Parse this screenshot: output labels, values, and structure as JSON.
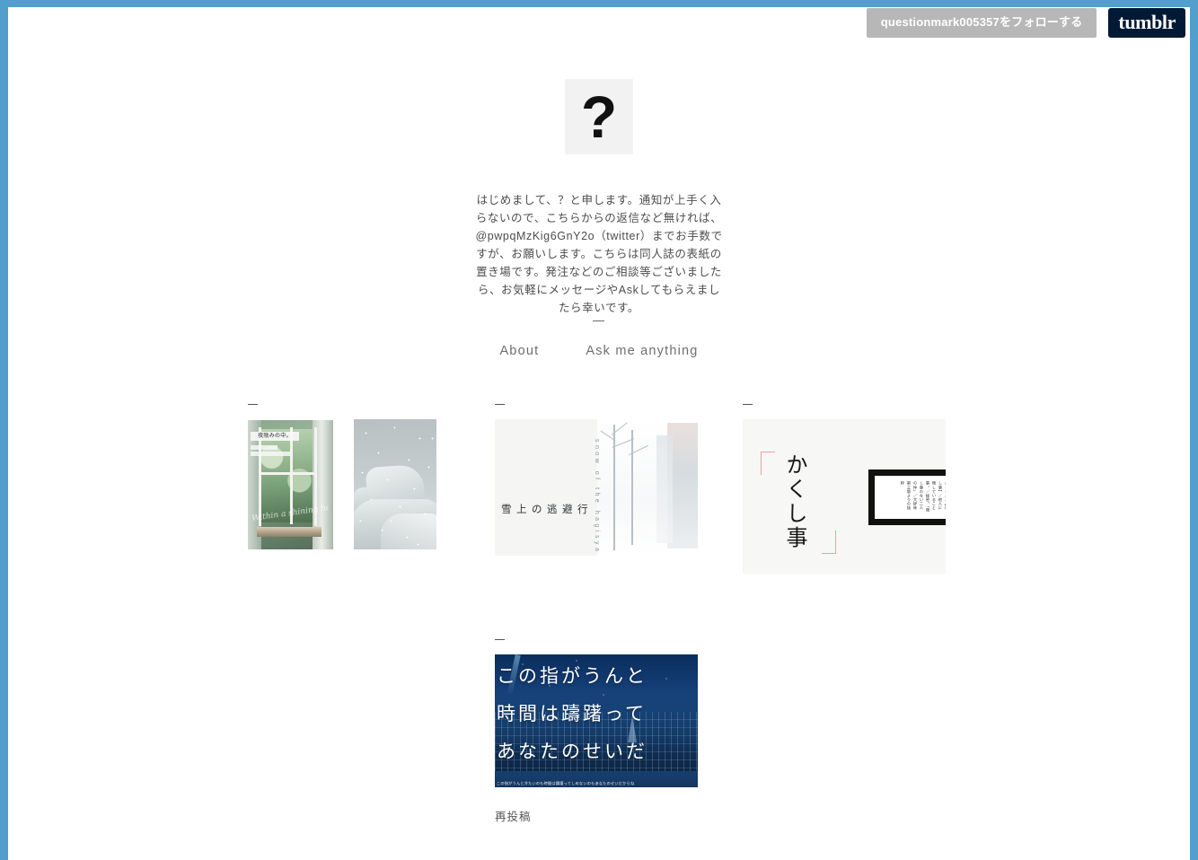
{
  "frame": {
    "accent_color": "#529ecc"
  },
  "follow_bar": {
    "follow_label": "questionmark005357をフォローする",
    "logo_label": "tumblr"
  },
  "header": {
    "avatar_glyph": "?",
    "description": "はじめまして、？と申します。通知が上手く入らないので、こちらからの返信など無ければ、@pwpqMzKig6GnY2o（twitter）までお手数ですが、お願いします。こちらは同人誌の表紙の置き場です。発注などのご相談等ございましたら、お気軽にメッセージやAskしてもらえましたら幸いです。",
    "nav": [
      {
        "label": "About"
      },
      {
        "label": "Ask me anything"
      }
    ]
  },
  "posts": [
    {
      "id": "post-1",
      "type": "photoset",
      "covers": [
        {
          "title": "夜陰みの中。",
          "subtitle_1": "Illust",
          "subtitle_2": "Novel / Ryouko",
          "script": "Within a shining hope / Within a shining night"
        },
        {
          "title": ""
        }
      ],
      "caption": ""
    },
    {
      "id": "post-2",
      "type": "photo",
      "title": "雪上の逃避行",
      "vertical_text": "snow of the hagisya",
      "caption": ""
    },
    {
      "id": "post-3",
      "type": "photo",
      "title": "かくし事",
      "definition": "かくしごと【隠し事】／他人に隠していること事。／秘密。「隠し事のない二人の仲」／大辞林 第三版よりの抜粋",
      "caption": ""
    },
    {
      "id": "post-4",
      "type": "photo",
      "lines": [
        "この指がうんと",
        "時間は躊躇って",
        "あなたのせいだ"
      ],
      "footnote": "この指がうんと冷たいのも時間は躊躇ってしめないのもあなたのせいだからね",
      "caption": "再投稿"
    }
  ]
}
